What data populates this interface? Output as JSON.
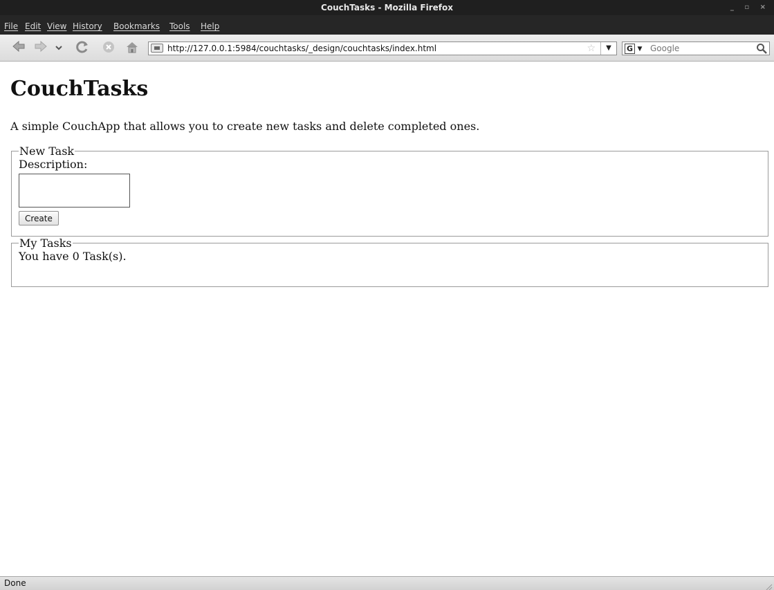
{
  "window": {
    "title": "CouchTasks - Mozilla Firefox",
    "controls": "_ ▫ ×"
  },
  "menubar": {
    "items": [
      "File",
      "Edit",
      "View",
      "History",
      "Bookmarks",
      "Tools",
      "Help"
    ]
  },
  "navbar": {
    "url": "http://127.0.0.1:5984/couchtasks/_design/couchtasks/index.html",
    "search_placeholder": "Google"
  },
  "page": {
    "title": "CouchTasks",
    "description": "A simple CouchApp that allows you to create new tasks and delete completed ones.",
    "new_task": {
      "legend": "New Task",
      "label": "Description:",
      "value": "",
      "button": "Create"
    },
    "my_tasks": {
      "legend": "My Tasks",
      "count_text": "You have 0 Task(s)."
    }
  },
  "status": {
    "text": "Done"
  }
}
